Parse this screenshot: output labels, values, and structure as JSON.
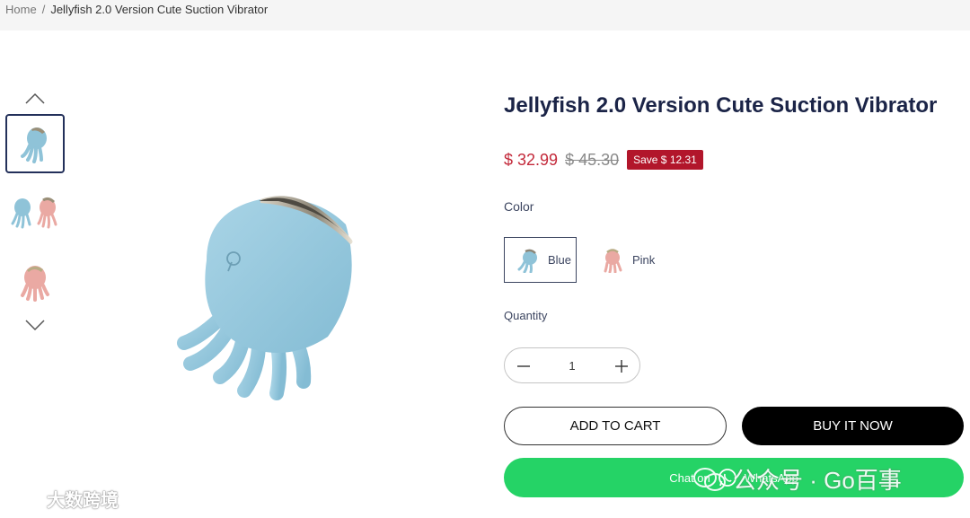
{
  "breadcrumb": {
    "home": "Home",
    "separator": "/",
    "current": "Jellyfish 2.0 Version Cute Suction Vibrator"
  },
  "gallery": {
    "prev_icon": "chevron-up-icon",
    "next_icon": "chevron-down-icon",
    "thumbnails": [
      "blue-jellyfish",
      "blue-and-pink-jellyfish",
      "pink-jellyfish"
    ],
    "active_index": 0
  },
  "product": {
    "title": "Jellyfish 2.0 Version Cute Suction Vibrator",
    "price": "$ 32.99",
    "compare_price": "$ 45.30",
    "save_badge": "Save $ 12.31",
    "color_label": "Color",
    "colors": [
      {
        "name": "Blue",
        "selected": true
      },
      {
        "name": "Pink",
        "selected": false
      }
    ],
    "quantity_label": "Quantity",
    "quantity": "1",
    "add_to_cart": "ADD TO CART",
    "buy_now": "BUY IT NOW",
    "whatsapp_prefix": "Chat on",
    "whatsapp_label": "WhatsApp"
  },
  "colors": {
    "accent_price": "#c3293a",
    "save_badge_bg": "#b2162b",
    "title": "#1b2447",
    "whatsapp_green": "#25d366",
    "buy_button": "#000000"
  },
  "watermarks": {
    "left": "大数跨境",
    "right": "公众号 · Go百事"
  }
}
